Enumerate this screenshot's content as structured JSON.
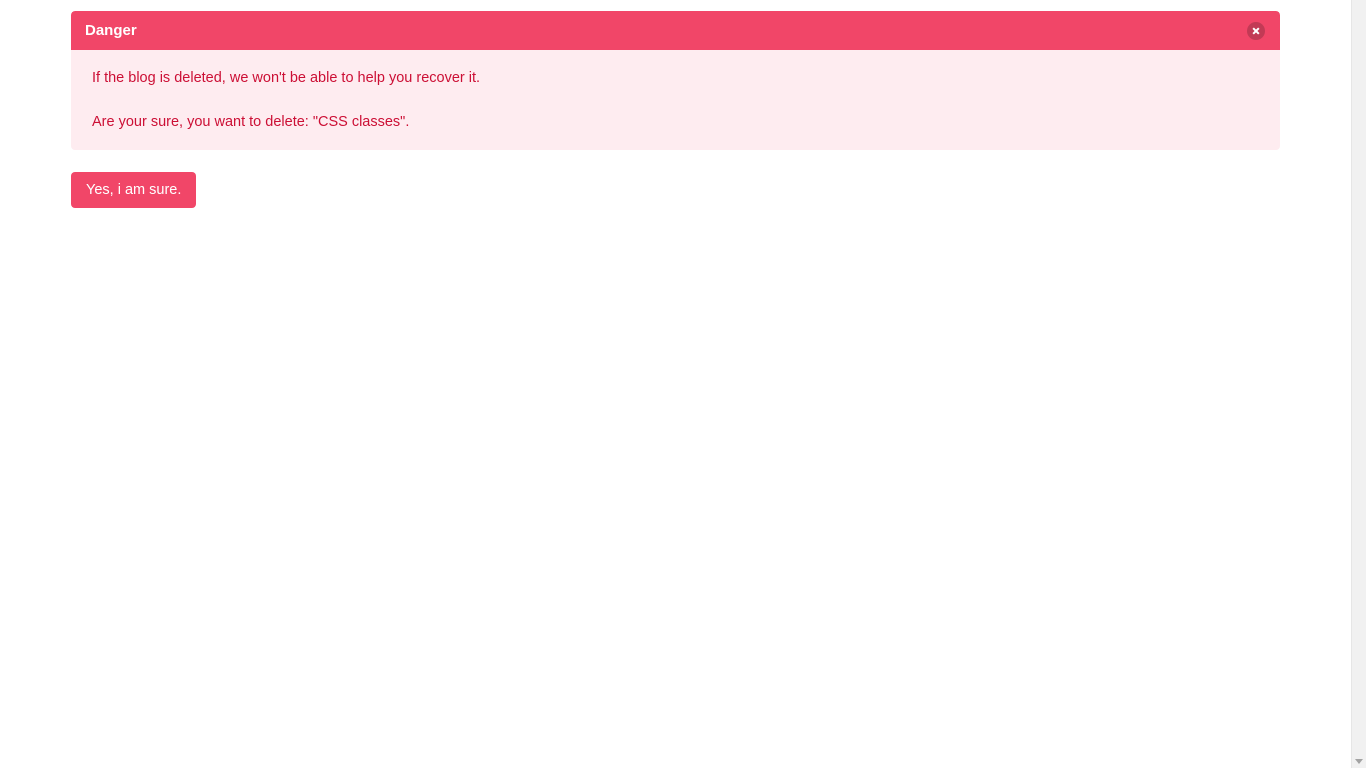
{
  "alert": {
    "title": "Danger",
    "close_icon": "close-icon",
    "line1": "If the blog is deleted, we won't be able to help you recover it.",
    "line2": "Are your sure, you want to delete: \"CSS classes\"."
  },
  "actions": {
    "confirm_label": "Yes, i am sure."
  },
  "colors": {
    "danger": "#f14668",
    "danger_light": "#feecf0",
    "danger_dark": "#cc0f35"
  }
}
